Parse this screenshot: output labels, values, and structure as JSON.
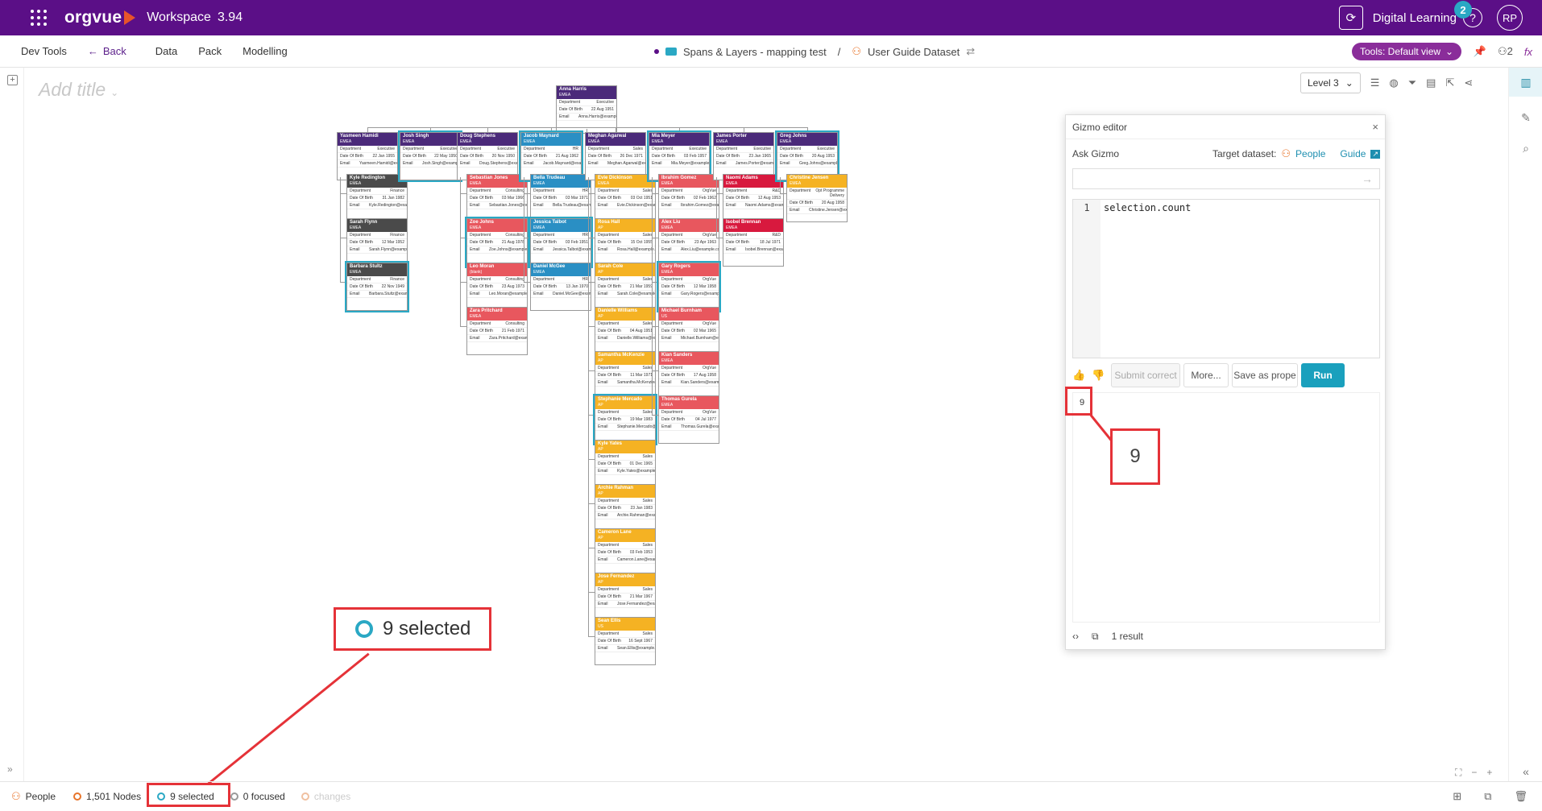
{
  "app": {
    "logo": "orgvue",
    "workspace": "Workspace",
    "version": "3.94",
    "user_initials": "RP",
    "digital_learning": "Digital Learning",
    "notif_count": "2",
    "help": "?"
  },
  "menu": {
    "dev_tools": "Dev Tools",
    "back": "Back",
    "data": "Data",
    "pack": "Pack",
    "modelling": "Modelling",
    "tools_view": "Tools: Default view",
    "users_count": "2",
    "fx": "fx"
  },
  "breadcrumb": {
    "project": "Spans & Layers - mapping test",
    "separator": "/",
    "dataset": "User Guide Dataset"
  },
  "canvas": {
    "add_title": "Add title",
    "level": "Level 3"
  },
  "gizmo": {
    "title": "Gizmo editor",
    "close": "×",
    "ask": "Ask Gizmo",
    "target_label": "Target dataset:",
    "target": "People",
    "guide": "Guide",
    "code_line_no": "1",
    "code": "selection.count",
    "btn_submit": "Submit correct",
    "btn_more": "More...",
    "btn_save": "Save as prope",
    "btn_run": "Run",
    "output_value": "9",
    "result_count": "1 result"
  },
  "callouts": {
    "zoom_value": "9",
    "selected_label": "9 selected"
  },
  "status": {
    "dataset": "People",
    "nodes": "1,501 Nodes",
    "selected": "9 selected",
    "focused": "0 focused",
    "changes": "changes"
  },
  "icons": [
    "apps-grid-icon",
    "sync-icon",
    "help-icon",
    "back-arrow-icon",
    "person-icon",
    "folder-icon",
    "filter-icon",
    "share-icon",
    "pin-icon",
    "chart-icon",
    "pencil-icon",
    "search-icon",
    "thumbs-up-icon",
    "thumbs-down-icon",
    "code-icon",
    "copy-icon"
  ],
  "colors": {
    "brand": "#5b0f87",
    "accent": "#1aa0bd",
    "callout": "#e53238"
  },
  "orgchart": {
    "root": {
      "name": "Anna Harris",
      "region": "EMEA",
      "dept": "Executive",
      "dob": "22 Aug 1951",
      "email": "Anna.Harris@example.com",
      "color": "#4b2a7a"
    },
    "columns": [
      {
        "lead": {
          "name": "Yasmeen Hamidi",
          "region": "EMEA",
          "dept": "Executive",
          "dob": "22 Jan 1955",
          "email": "Yasmeen.Hamidi@example.com",
          "color": "#4b2a7a",
          "sel": false
        },
        "reports": [
          {
            "name": "Kyle Redington",
            "region": "EMEA",
            "dept": "Finance",
            "dob": "31 Jan 1982",
            "email": "Kyle.Redington@example.com",
            "color": "#4a4a4a",
            "sel": false
          },
          {
            "name": "Sarah Flynn",
            "region": "EMEA",
            "dept": "Finance",
            "dob": "12 Mar 1952",
            "email": "Sarah.Flynn@example.com",
            "color": "#4a4a4a",
            "sel": false
          },
          {
            "name": "Barbara Stultz",
            "region": "EMEA",
            "dept": "Finance",
            "dob": "22 Nov 1949",
            "email": "Barbara.Stultz@example.com",
            "color": "#4a4a4a",
            "sel": true
          }
        ]
      },
      {
        "lead": {
          "name": "Josh Singh",
          "region": "EMEA",
          "dept": "Executive",
          "dob": "22 May 1950",
          "email": "Josh.Singh@example.com",
          "color": "#4b2a7a",
          "sel": true
        },
        "reports": []
      },
      {
        "lead": {
          "name": "Doug Stephens",
          "region": "EMEA",
          "dept": "Executive",
          "dob": "20 Nov 1950",
          "email": "Doug.Stephens@example.com",
          "color": "#4b2a7a",
          "sel": false
        },
        "reports": [
          {
            "name": "Sebastian Jones",
            "region": "EMEA",
            "dept": "Consulting",
            "dob": "03 Mar 1966",
            "email": "Sebastian.Jones@example.com",
            "color": "#e8575e",
            "sel": false
          },
          {
            "name": "Zoe Johns",
            "region": "EMEA",
            "dept": "Consulting",
            "dob": "21 Aug 1978",
            "email": "Zoe.Johns@example.com",
            "color": "#e8575e",
            "sel": true
          },
          {
            "name": "Leo Moran",
            "region": "(blank)",
            "dept": "Consulting",
            "dob": "23 Aug 1973",
            "email": "Leo.Moran@example.com",
            "color": "#e8575e",
            "sel": false
          },
          {
            "name": "Zara Pritchard",
            "region": "EMEA",
            "dept": "Consulting",
            "dob": "21 Feb 1971",
            "email": "Zara.Pritchard@example.com",
            "color": "#e8575e",
            "sel": false
          }
        ]
      },
      {
        "lead": {
          "name": "Jacob Maynard",
          "region": "EMEA",
          "dept": "HR",
          "dob": "21 Aug 1962",
          "email": "Jacob.Maynard@example.com",
          "color": "#2a8fc4",
          "sel": true
        },
        "reports": [
          {
            "name": "Bella Trudeau",
            "region": "EMEA",
            "dept": "HR",
            "dob": "03 Mar 1971",
            "email": "Bella.Trudeau@example.com",
            "color": "#2a8fc4",
            "sel": false
          },
          {
            "name": "Jessica Talbot",
            "region": "EMEA",
            "dept": "HR",
            "dob": "03 Feb 1951",
            "email": "Jessica.Talbot@example.com",
            "color": "#2a8fc4",
            "sel": true
          },
          {
            "name": "Daniel McGee",
            "region": "EMEA",
            "dept": "HR",
            "dob": "13 Jan 1970",
            "email": "Daniel.McGee@example.com",
            "color": "#2a8fc4",
            "sel": false
          }
        ]
      },
      {
        "lead": {
          "name": "Meghan Agarwal",
          "region": "EMEA",
          "dept": "Sales",
          "dob": "26 Dec 1971",
          "email": "Meghan.Agarwal@example.com",
          "color": "#4b2a7a",
          "sel": false
        },
        "reports": [
          {
            "name": "Evie Dickinson",
            "region": "EMEA",
            "dept": "Sales",
            "dob": "03 Oct 1951",
            "email": "Evie.Dickinson@example.com",
            "color": "#f5b223",
            "sel": false
          },
          {
            "name": "Rosa Hall",
            "region": "AP",
            "dept": "Sales",
            "dob": "15 Oct 1955",
            "email": "Rosa.Hall@example.com",
            "color": "#f5b223",
            "sel": false
          },
          {
            "name": "Sarah Cole",
            "region": "AP",
            "dept": "Sales",
            "dob": "21 Mar 1959",
            "email": "Sarah.Cole@example.com",
            "color": "#f5b223",
            "sel": false
          },
          {
            "name": "Danielle Williams",
            "region": "AP",
            "dept": "Sales",
            "dob": "04 Aug 1951",
            "email": "Danielle.Williams@example.com",
            "color": "#f5b223",
            "sel": false
          },
          {
            "name": "Samantha McKenzie",
            "region": "AP",
            "dept": "Sales",
            "dob": "11 Mar 1971",
            "email": "Samantha.McKenzie@example.com",
            "color": "#f5b223",
            "sel": false
          },
          {
            "name": "Stephanie Mercado",
            "region": "AP",
            "dept": "Sales",
            "dob": "19 Mar 1983",
            "email": "Stephanie.Mercado@example.com",
            "color": "#f5b223",
            "sel": true
          },
          {
            "name": "Kyle Yates",
            "region": "AP",
            "dept": "Sales",
            "dob": "01 Dec 1965",
            "email": "Kyle.Yates@example.com",
            "color": "#f5b223",
            "sel": false
          },
          {
            "name": "Archie Rahman",
            "region": "AP",
            "dept": "Sales",
            "dob": "23 Jan 1983",
            "email": "Archie.Rahman@example.com",
            "color": "#f5b223",
            "sel": false
          },
          {
            "name": "Cameron Lane",
            "region": "AP",
            "dept": "Sales",
            "dob": "03 Feb 1953",
            "email": "Cameron.Lane@example.com",
            "color": "#f5b223",
            "sel": false
          },
          {
            "name": "Jose Fernandez",
            "region": "AP",
            "dept": "Sales",
            "dob": "21 Mar 1967",
            "email": "Jose.Fernandez@example.com",
            "color": "#f5b223",
            "sel": false
          },
          {
            "name": "Sean Ellis",
            "region": "US",
            "dept": "Sales",
            "dob": "16 Sept 1967",
            "email": "Sean.Ellis@example.com",
            "color": "#f5b223",
            "sel": false
          }
        ]
      },
      {
        "lead": {
          "name": "Mia Meyer",
          "region": "EMEA",
          "dept": "Executive",
          "dob": "03 Feb 1957",
          "email": "Mia.Meyer@example.com",
          "color": "#4b2a7a",
          "sel": true
        },
        "reports": [
          {
            "name": "Ibrahim Gomez",
            "region": "EMEA",
            "dept": "OrgVue",
            "dob": "02 Feb 1962",
            "email": "Ibrahim.Gomez@example.com",
            "color": "#e8575e",
            "sel": false
          },
          {
            "name": "Alex Liu",
            "region": "EMEA",
            "dept": "OrgVue",
            "dob": "23 Apr 1963",
            "email": "Alex.Liu@example.com",
            "color": "#e8575e",
            "sel": false
          },
          {
            "name": "Gary Rogers",
            "region": "EMEA",
            "dept": "OrgVue",
            "dob": "12 Mar 1958",
            "email": "Gary.Rogers@example.com",
            "color": "#e8575e",
            "sel": true
          },
          {
            "name": "Michael Burnham",
            "region": "US",
            "dept": "OrgVue",
            "dob": "02 Mar 1965",
            "email": "Michael.Burnham@example.com",
            "color": "#e8575e",
            "sel": false
          },
          {
            "name": "Kian Sanders",
            "region": "EMEA",
            "dept": "OrgVue",
            "dob": "17 Aug 1958",
            "email": "Kian.Sanders@example.com",
            "color": "#e8575e",
            "sel": false
          },
          {
            "name": "Thomas Gurela",
            "region": "EMEA",
            "dept": "OrgVue",
            "dob": "04 Jul 1977",
            "email": "Thomas.Gurela@example.com",
            "color": "#e8575e",
            "sel": false
          }
        ]
      },
      {
        "lead": {
          "name": "James Porter",
          "region": "EMEA",
          "dept": "Executive",
          "dob": "23 Jan 1965",
          "email": "James.Porter@example.com",
          "color": "#4b2a7a",
          "sel": false
        },
        "reports": [
          {
            "name": "Naomi Adams",
            "region": "EMEA",
            "dept": "R&D",
            "dob": "12 Aug 1953",
            "email": "Naomi.Adams@example.com",
            "color": "#d8193e",
            "sel": false
          },
          {
            "name": "Isobel Brennan",
            "region": "EMEA",
            "dept": "R&D",
            "dob": "18 Jul 1971",
            "email": "Isobel.Brennan@example.com",
            "color": "#d8193e",
            "sel": false
          }
        ]
      },
      {
        "lead": {
          "name": "Greg Johns",
          "region": "EMEA",
          "dept": "Executive",
          "dob": "20 Aug 1953",
          "email": "Greg.Johns@example.com",
          "color": "#4b2a7a",
          "sel": true
        },
        "reports": [
          {
            "name": "Christine Jensen",
            "region": "EMEA",
            "dept": "Opt Programme Delivery",
            "dob": "20 Aug 1958",
            "email": "Christine.Jensen@example.com",
            "color": "#f5b223",
            "sel": false
          }
        ]
      }
    ]
  }
}
